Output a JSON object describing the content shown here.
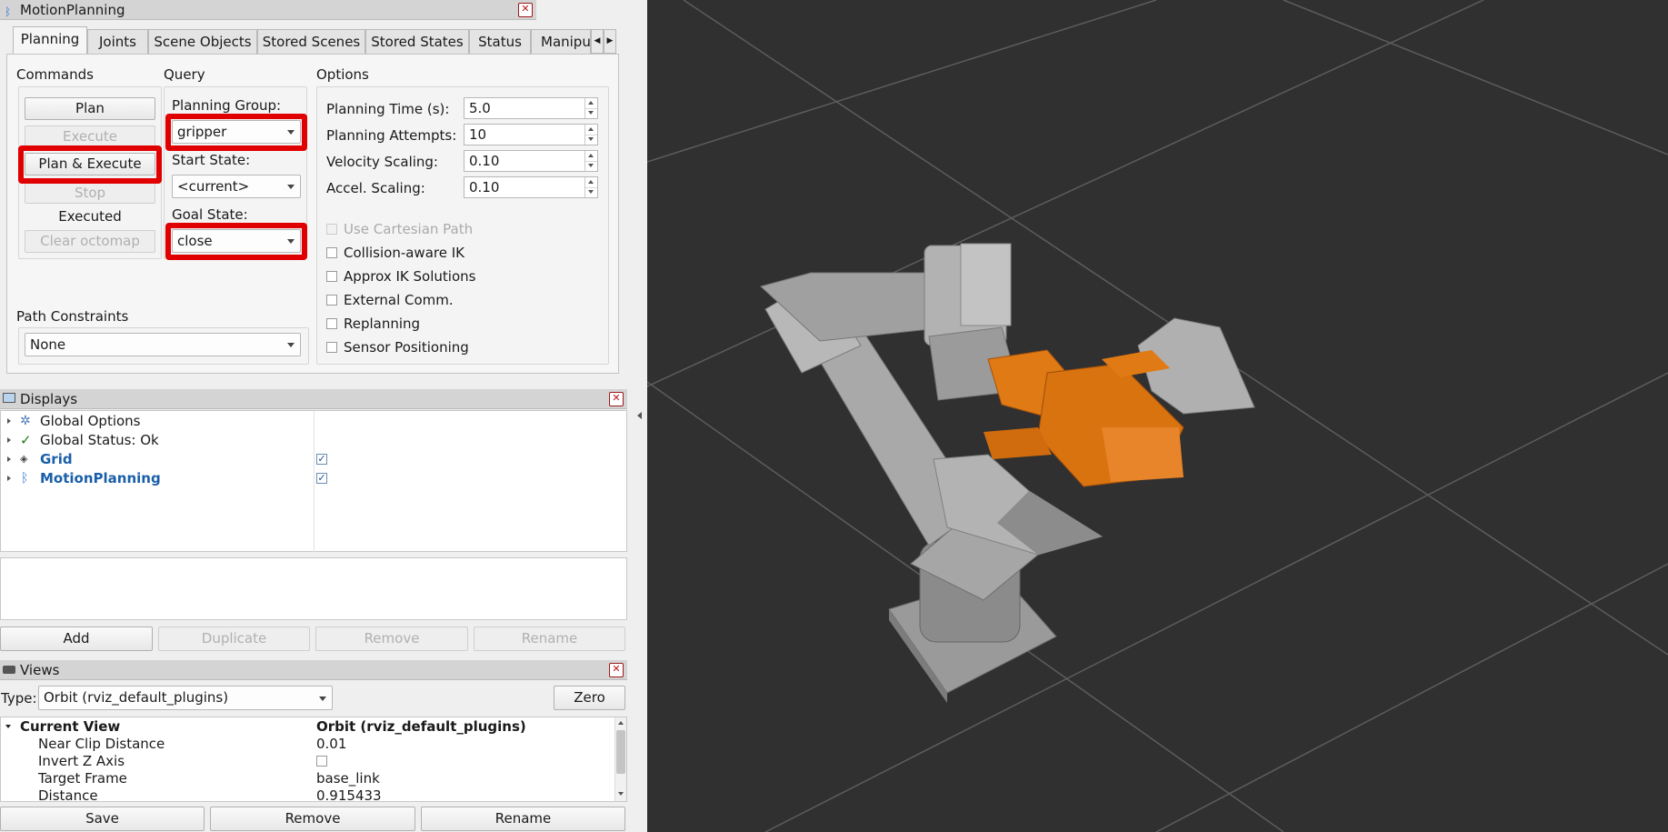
{
  "motion_panel": {
    "title": "MotionPlanning",
    "tabs": [
      "Planning",
      "Joints",
      "Scene Objects",
      "Stored Scenes",
      "Stored States",
      "Status",
      "Manipul"
    ],
    "commands": {
      "label": "Commands",
      "plan": "Plan",
      "execute": "Execute",
      "plan_execute": "Plan & Execute",
      "stop": "Stop",
      "status": "Executed",
      "clear_octomap": "Clear octomap"
    },
    "query": {
      "label": "Query",
      "planning_group_label": "Planning Group:",
      "planning_group": "gripper",
      "start_state_label": "Start State:",
      "start_state": "<current>",
      "goal_state_label": "Goal State:",
      "goal_state": "close"
    },
    "options": {
      "label": "Options",
      "planning_time_label": "Planning Time (s):",
      "planning_time": "5.0",
      "planning_attempts_label": "Planning Attempts:",
      "planning_attempts": "10",
      "velocity_scaling_label": "Velocity Scaling:",
      "velocity_scaling": "0.10",
      "accel_scaling_label": "Accel. Scaling:",
      "accel_scaling": "0.10",
      "checkboxes": [
        "Use Cartesian Path",
        "Collision-aware IK",
        "Approx IK Solutions",
        "External Comm.",
        "Replanning",
        "Sensor Positioning"
      ]
    },
    "path_constraints": {
      "label": "Path Constraints",
      "value": "None"
    }
  },
  "displays": {
    "title": "Displays",
    "items": [
      "Global Options",
      "Global Status: Ok",
      "Grid",
      "MotionPlanning"
    ],
    "buttons": [
      "Add",
      "Duplicate",
      "Remove",
      "Rename"
    ]
  },
  "views": {
    "title": "Views",
    "type_label": "Type:",
    "type_value": "Orbit (rviz_default_plugins)",
    "zero": "Zero",
    "current_view_label": "Current View",
    "current_view_value": "Orbit (rviz_default_plugins)",
    "properties": [
      {
        "name": "Near Clip Distance",
        "value": "0.01"
      },
      {
        "name": "Invert Z Axis",
        "value": ""
      },
      {
        "name": "Target Frame",
        "value": "base_link"
      },
      {
        "name": "Distance",
        "value": "0.915433"
      }
    ],
    "buttons": [
      "Save",
      "Remove",
      "Rename"
    ]
  },
  "viewport": {
    "background": "#303030",
    "gripper_color": "#e07a14",
    "arm_color": "#8f8f8f"
  },
  "colors": {
    "highlight": "#e10000",
    "link_blue": "#1a5fa8"
  }
}
